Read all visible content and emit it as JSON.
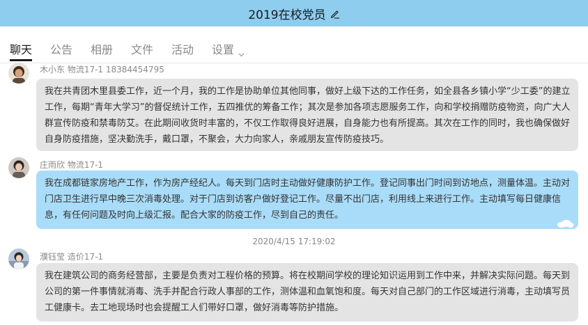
{
  "header": {
    "title": "2019在校党员",
    "edit_icon": "edit-pencil-icon"
  },
  "tabs": [
    {
      "label": "聊天",
      "active": true
    },
    {
      "label": "公告"
    },
    {
      "label": "相册"
    },
    {
      "label": "文件"
    },
    {
      "label": "活动"
    },
    {
      "label": "设置"
    }
  ],
  "messages": [
    {
      "sender": "木小东  物流17-1   18384454795",
      "text": "我在共青团木里县委工作，近一个月，我的工作是协助单位其他同事，做好上级下达的工作任务，如全县各乡镇小学“少工委”的建立工作，每期“青年大学习”的督促统计工作，五四推优的筹备工作；其次是参加各项志愿服务工作，向和学校捐赠防疫物资，向广大人群宣传防疫和禁毒防艾。在此期间收货时丰富的，不仅工作取得良好进展，自身能力也有所提高。其次在工作的同时，我也确保做好自身防疫措施，坚决勤洗手，戴口罩，不聚会，大力向家人，亲戚朋友宣传防疫技巧。"
    },
    {
      "sender": "庄雨欣  物流17-1",
      "text": "我在成都链家房地产工作，作为房产经纪人。每天到门店时主动做好健康防护工作。登记同事出门时间到访地点，测量体温。主动对门店卫生进行早中晚三次消毒处理。对于门店到访客户做好登记工作。尽量不出门店，利用线上来进行工作。主动填写每日健康信息，有任何问题及时向上级汇报。配合大家的防疫工作，尽到自己的责任。"
    },
    {
      "timestamp": "2020/4/15 17:19:02"
    },
    {
      "sender": "濮钰莹  造价17-1",
      "text": "我在建筑公司的商务经营部，主要是负责对工程价格的预算。将在校期间学校的理论知识运用到工作中来，并解决实际问题。每天到公司的第一件事情就消毒、洗手并配合行政人事部的工作，测体温和血氧饱和度。每天对自己部门的工作区域进行消毒，主动填写员工健康卡。去工地现场时也会提醒工人们带好口罩，做好消毒等防护措施。"
    }
  ],
  "colors": {
    "header_bg": "#8fcdef",
    "bubble_gray": "#e4e4e4",
    "bubble_blue": "#a9dcf8"
  }
}
